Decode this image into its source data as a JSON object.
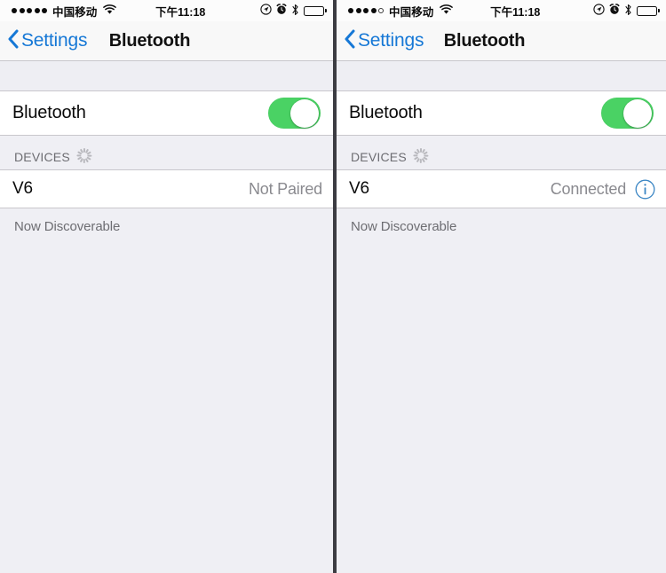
{
  "app": {
    "screen_title": "Bluetooth",
    "back_label": "Settings"
  },
  "status_bar": {
    "carrier": "中国移动",
    "time": "下午11:18",
    "signal_dots_total": 5,
    "icons": [
      "location-icon",
      "alarm-clock-icon",
      "bluetooth-icon",
      "battery-icon"
    ]
  },
  "panels": [
    {
      "id": "left",
      "status_bar": {
        "carrier": "中国移动",
        "time": "下午11:18",
        "signal_filled": 5,
        "signal_total": 5
      },
      "nav": {
        "back_label": "Settings",
        "title": "Bluetooth"
      },
      "toggle_row": {
        "label": "Bluetooth",
        "state": "on"
      },
      "section": {
        "header": "DEVICES",
        "spinner": true
      },
      "device": {
        "name": "V6",
        "status": "Not Paired",
        "has_info_button": false
      },
      "footer": "Now Discoverable"
    },
    {
      "id": "right",
      "status_bar": {
        "carrier": "中国移动",
        "time": "下午11:18",
        "signal_filled": 4,
        "signal_total": 5
      },
      "nav": {
        "back_label": "Settings",
        "title": "Bluetooth"
      },
      "toggle_row": {
        "label": "Bluetooth",
        "state": "on"
      },
      "section": {
        "header": "DEVICES",
        "spinner": true
      },
      "device": {
        "name": "V6",
        "status": "Connected",
        "has_info_button": true
      },
      "footer": "Now Discoverable"
    }
  ],
  "colors": {
    "tint_blue": "#1678d6",
    "switch_green": "#4ad264",
    "secondary_text": "#8a8a8f",
    "separator": "#c8c7cc",
    "group_background": "#efeff4",
    "cell_background": "#ffffff"
  }
}
